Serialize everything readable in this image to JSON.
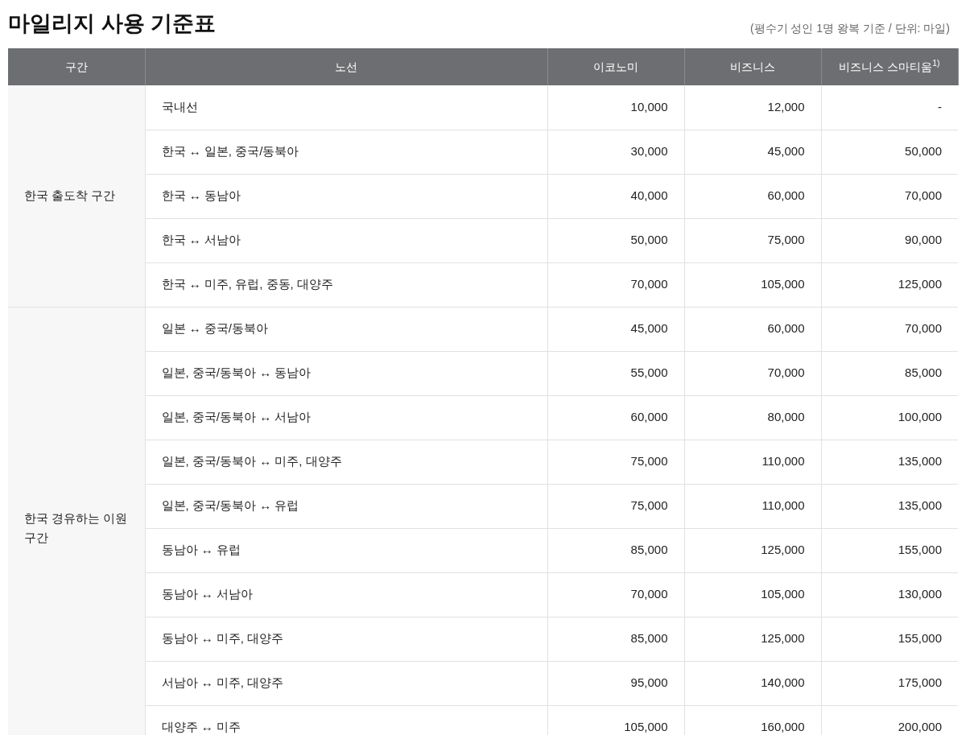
{
  "title": "마일리지 사용 기준표",
  "note": "(평수기 성인 1명 왕복 기준 / 단위: 마일)",
  "columns": [
    "구간",
    "노선",
    "이코노미",
    "비즈니스",
    "비즈니스 스마티움$^{1)}$"
  ],
  "groups": [
    {
      "label": "한국 출도착 구간",
      "rows": [
        {
          "route": "국내선",
          "economy": "10,000",
          "business": "12,000",
          "smartium": "-"
        },
        {
          "route": "한국 ↔ 일본, 중국/동북아",
          "economy": "30,000",
          "business": "45,000",
          "smartium": "50,000"
        },
        {
          "route": "한국 ↔ 동남아",
          "economy": "40,000",
          "business": "60,000",
          "smartium": "70,000"
        },
        {
          "route": "한국 ↔ 서남아",
          "economy": "50,000",
          "business": "75,000",
          "smartium": "90,000"
        },
        {
          "route": "한국 ↔ 미주, 유럽, 중동, 대양주",
          "economy": "70,000",
          "business": "105,000",
          "smartium": "125,000"
        }
      ]
    },
    {
      "label": "한국 경유하는 이원구간",
      "rows": [
        {
          "route": "일본 ↔ 중국/동북아",
          "economy": "45,000",
          "business": "60,000",
          "smartium": "70,000"
        },
        {
          "route": "일본, 중국/동북아 ↔ 동남아",
          "economy": "55,000",
          "business": "70,000",
          "smartium": "85,000"
        },
        {
          "route": "일본, 중국/동북아 ↔ 서남아",
          "economy": "60,000",
          "business": "80,000",
          "smartium": "100,000"
        },
        {
          "route": "일본, 중국/동북아 ↔ 미주, 대양주",
          "economy": "75,000",
          "business": "110,000",
          "smartium": "135,000"
        },
        {
          "route": "일본, 중국/동북아 ↔ 유럽",
          "economy": "75,000",
          "business": "110,000",
          "smartium": "135,000"
        },
        {
          "route": "동남아 ↔ 유럽",
          "economy": "85,000",
          "business": "125,000",
          "smartium": "155,000"
        },
        {
          "route": "동남아 ↔ 서남아",
          "economy": "70,000",
          "business": "105,000",
          "smartium": "130,000"
        },
        {
          "route": "동남아 ↔ 미주, 대양주",
          "economy": "85,000",
          "business": "125,000",
          "smartium": "155,000"
        },
        {
          "route": "서남아 ↔ 미주, 대양주",
          "economy": "95,000",
          "business": "140,000",
          "smartium": "175,000"
        },
        {
          "route": "대양주 ↔ 미주",
          "economy": "105,000",
          "business": "160,000",
          "smartium": "200,000"
        }
      ]
    }
  ]
}
